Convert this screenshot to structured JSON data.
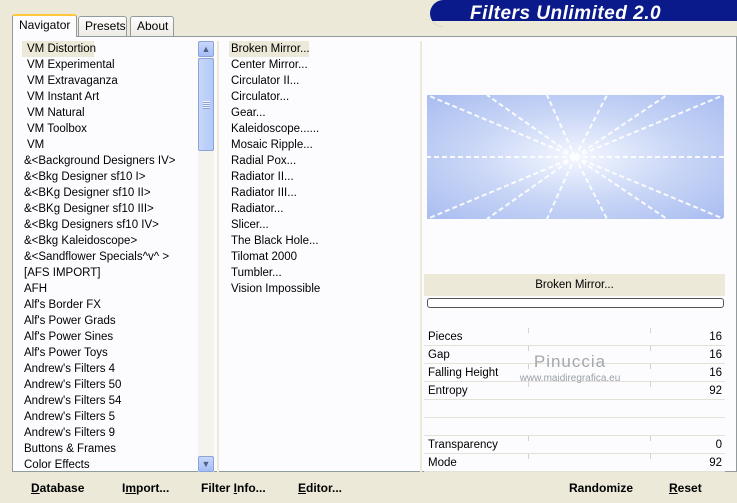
{
  "tabs": [
    {
      "label": "Navigator"
    },
    {
      "label": "Presets"
    },
    {
      "label": "About"
    }
  ],
  "banner": {
    "title": "Filters Unlimited 2.0"
  },
  "categories": [
    "VM Distortion",
    "VM Experimental",
    "VM Extravaganza",
    "VM Instant Art",
    "VM Natural",
    "VM Toolbox",
    "VM",
    "&<Background Designers IV>",
    "&<Bkg Designer sf10 I>",
    "&<BKg Designer sf10 II>",
    "&<BKg Designer sf10 III>",
    "&<Bkg Designers sf10 IV>",
    "&<Bkg Kaleidoscope>",
    "&<Sandflower Specials^v^ >",
    "[AFS IMPORT]",
    "AFH",
    "Alf's Border FX",
    "Alf's Power Grads",
    "Alf's Power Sines",
    "Alf's Power Toys",
    "Andrew's Filters 4",
    "Andrew's Filters 50",
    "Andrew's Filters 54",
    "Andrew's Filters 5",
    "Andrew's Filters 9",
    "Buttons & Frames",
    "Color Effects"
  ],
  "filters": [
    "Broken Mirror...",
    "Center Mirror...",
    "Circulator II...",
    "Circulator...",
    "Gear...",
    "Kaleidoscope......",
    "Mosaic Ripple...",
    "Radial Pox...",
    "Radiator II...",
    "Radiator III...",
    "Radiator...",
    "Slicer...",
    "The Black Hole...",
    "Tilomat 2000",
    "Tumbler...",
    "Vision Impossible"
  ],
  "selected_filter_label": "Broken Mirror...",
  "params": [
    {
      "label": "Pieces",
      "value": "16"
    },
    {
      "label": "Gap",
      "value": "16"
    },
    {
      "label": "Falling Height",
      "value": "16"
    },
    {
      "label": "Entropy",
      "value": "92"
    },
    {
      "label": "",
      "value": ""
    },
    {
      "label": "",
      "value": ""
    },
    {
      "label": "Transparency",
      "value": "0"
    },
    {
      "label": "Mode",
      "value": "92"
    }
  ],
  "watermark": {
    "line1": "Pinuccia",
    "line2": "www.maidiregrafica.eu"
  },
  "buttons": {
    "database_u": "D",
    "database_rest": "atabase",
    "import_pre": "I",
    "import_u": "m",
    "import_rest": "port...",
    "filterinfo_pre": "Filter ",
    "filterinfo_u": "I",
    "filterinfo_rest": "nfo...",
    "editor_u": "E",
    "editor_rest": "ditor...",
    "randomize": "Randomize",
    "reset_u": "R",
    "reset_rest": "eset"
  },
  "colors": {
    "banner": "#0a1a8a",
    "selection": "#ece9d8",
    "preview_blue": "#b8c8f0"
  }
}
